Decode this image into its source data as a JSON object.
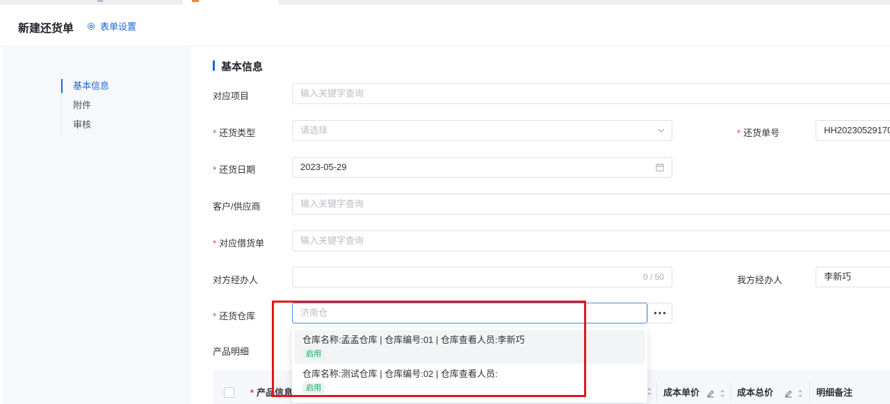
{
  "header": {
    "title": "新建还货单",
    "form_settings": "表单设置"
  },
  "anchor_nav": {
    "items": [
      "基本信息",
      "附件",
      "审核"
    ]
  },
  "section": {
    "title": "基本信息"
  },
  "fields": {
    "project": {
      "label": "对应项目",
      "placeholder": "输入关键字查询"
    },
    "return_type": {
      "label": "还货类型",
      "placeholder": "请选择"
    },
    "return_no": {
      "label": "还货单号",
      "value": "HH20230529170"
    },
    "return_date": {
      "label": "还货日期",
      "value": "2023-05-29"
    },
    "customer": {
      "label": "客户/供应商",
      "placeholder": "输入关键字查询"
    },
    "borrow_order": {
      "label": "对应借货单",
      "placeholder": "输入关键字查询"
    },
    "their_handler": {
      "label": "对方经办人",
      "counter": "0 / 50"
    },
    "our_handler": {
      "label": "我方经办人",
      "value": "李新巧"
    },
    "warehouse": {
      "label": "还货仓库",
      "value": "济南仓"
    },
    "product_detail": {
      "label": "产品明细"
    }
  },
  "dropdown": {
    "options": [
      {
        "text": "仓库名称:孟孟仓库 | 仓库编号:01 | 仓库查看人员:李新巧",
        "tag": "启用"
      },
      {
        "text": "仓库名称:测试仓库 | 仓库编号:02 | 仓库查看人员:",
        "tag": "启用"
      }
    ]
  },
  "table": {
    "columns": [
      "产品信息",
      "成本单价",
      "成本总价",
      "明细备注"
    ]
  },
  "colors": {
    "accent": "#1a66d9",
    "required": "#e23c39",
    "annotation": "#e8121b",
    "tag_green": "#1ba16a"
  }
}
